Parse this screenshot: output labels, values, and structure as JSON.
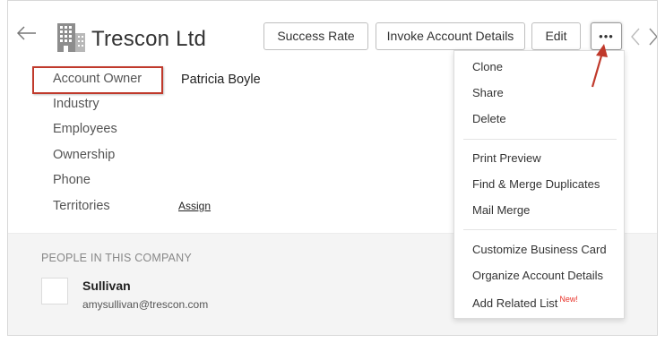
{
  "header": {
    "title": "Trescon Ltd",
    "buttons": {
      "success_rate": "Success Rate",
      "invoke_account_details": "Invoke Account Details",
      "edit": "Edit",
      "more": "•••"
    }
  },
  "fields": [
    {
      "label": "Account Owner",
      "value": "Patricia Boyle"
    },
    {
      "label": "Industry",
      "value": ""
    },
    {
      "label": "Employees",
      "value": ""
    },
    {
      "label": "Ownership",
      "value": ""
    },
    {
      "label": "Phone",
      "value": ""
    },
    {
      "label": "Territories",
      "value": "Assign"
    }
  ],
  "people": {
    "heading": "PEOPLE IN THIS COMPANY",
    "contacts": [
      {
        "name": "Sullivan",
        "email": "amysullivan@trescon.com"
      }
    ]
  },
  "more_menu": {
    "groups": [
      [
        "Clone",
        "Share",
        "Delete"
      ],
      [
        "Print Preview",
        "Find & Merge Duplicates",
        "Mail Merge"
      ],
      [
        "Customize Business Card",
        "Organize Account Details",
        "Add Related List"
      ]
    ],
    "new_badge": "New!"
  },
  "colors": {
    "highlight": "#c0392b",
    "arrow": "#c0392b",
    "new_badge": "#e8332a",
    "section_background": "#f4f4f4"
  },
  "icons": {
    "back": "back-arrow-icon",
    "company": "building-icon",
    "previous": "chevron-left-icon",
    "next": "chevron-right-icon"
  }
}
